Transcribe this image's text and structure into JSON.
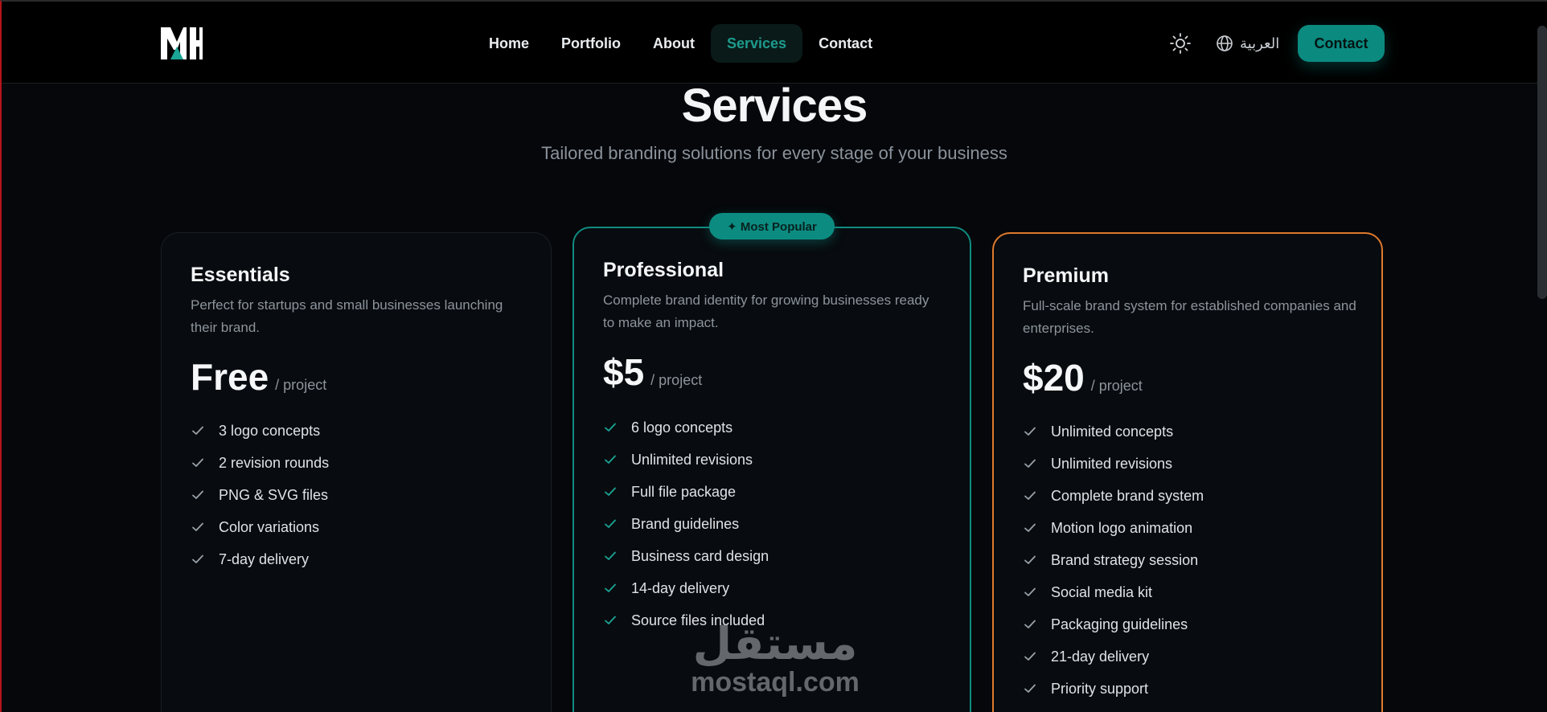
{
  "header": {
    "logo_text": "MH",
    "nav": [
      {
        "label": "Home",
        "active": false
      },
      {
        "label": "Portfolio",
        "active": false
      },
      {
        "label": "About",
        "active": false
      },
      {
        "label": "Services",
        "active": true
      },
      {
        "label": "Contact",
        "active": false
      }
    ],
    "theme_icon": "sun-icon",
    "language_icon": "globe-icon",
    "language_label": "العربية",
    "contact_label": "Contact"
  },
  "hero": {
    "title": "Services",
    "subtitle": "Tailored branding solutions for every stage of your business"
  },
  "colors": {
    "accent": "#0b8a80",
    "premium_border": "#e07a2d",
    "background": "#05070a"
  },
  "plans": [
    {
      "name": "Essentials",
      "description": "Perfect for startups and small businesses launching their brand.",
      "price": "Free",
      "unit": "/ project",
      "features": [
        "3 logo concepts",
        "2 revision rounds",
        "PNG & SVG files",
        "Color variations",
        "7-day delivery"
      ]
    },
    {
      "name": "Professional",
      "badge": "✦ Most Popular",
      "description": "Complete brand identity for growing businesses ready to make an impact.",
      "price": "$5",
      "unit": "/ project",
      "features": [
        "6 logo concepts",
        "Unlimited revisions",
        "Full file package",
        "Brand guidelines",
        "Business card design",
        "14-day delivery",
        "Source files included"
      ]
    },
    {
      "name": "Premium",
      "description": "Full-scale brand system for established companies and enterprises.",
      "price": "$20",
      "unit": "/ project",
      "features": [
        "Unlimited concepts",
        "Unlimited revisions",
        "Complete brand system",
        "Motion logo animation",
        "Brand strategy session",
        "Social media kit",
        "Packaging guidelines",
        "21-day delivery",
        "Priority support"
      ]
    }
  ],
  "watermark": {
    "arabic": "مستقل",
    "latin": "mostaql.com"
  }
}
